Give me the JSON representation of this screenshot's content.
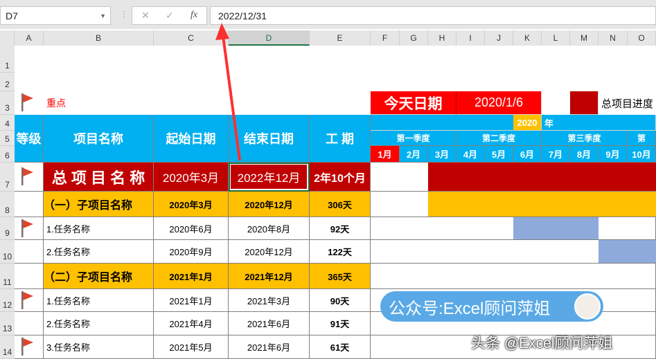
{
  "formula_bar": {
    "name_box": "D7",
    "formula": "2022/12/31",
    "cancel_icon": "✕",
    "confirm_icon": "✓",
    "fx_label": "fx"
  },
  "columns": [
    "A",
    "B",
    "C",
    "D",
    "E",
    "F",
    "G",
    "H",
    "I",
    "J",
    "K",
    "L",
    "M",
    "N",
    "O"
  ],
  "selected_column": "D",
  "rows": [
    "1",
    "2",
    "3",
    "4",
    "5",
    "6",
    "7",
    "8",
    "9",
    "10",
    "11",
    "12",
    "13",
    "14"
  ],
  "legend": {
    "flag_label": "重点",
    "today_label": "今天日期",
    "today_value": "2020/1/6",
    "overall_progress_label": "总项目进度"
  },
  "header": {
    "level": "等级",
    "name": "项目名称",
    "start": "起始日期",
    "end": "结束日期",
    "duration": "工 期",
    "year": "2020",
    "year_suffix": "年",
    "quarters": [
      "第一季度",
      "第二季度",
      "第三季度",
      "第"
    ],
    "months": [
      "1月",
      "2月",
      "3月",
      "4月",
      "5月",
      "6月",
      "7月",
      "8月",
      "9月",
      "10月"
    ]
  },
  "tasks": [
    {
      "flag": true,
      "name": "总 项 目 名 称",
      "start": "2020年3月",
      "end": "2022年12月",
      "duration": "2年10个月",
      "type": "total",
      "gantt_from_month": 3,
      "gantt_to_month": 12
    },
    {
      "flag": false,
      "name": "（一）子项目名称",
      "start": "2020年3月",
      "end": "2020年12月",
      "duration": "306天",
      "type": "sub",
      "gantt_from_month": 3,
      "gantt_to_month": 12
    },
    {
      "flag": true,
      "name": "1.任务名称",
      "start": "2020年6月",
      "end": "2020年8月",
      "duration": "92天",
      "type": "task",
      "gantt_from_month": 6,
      "gantt_to_month": 8
    },
    {
      "flag": false,
      "name": "2.任务名称",
      "start": "2020年9月",
      "end": "2020年12月",
      "duration": "122天",
      "type": "task",
      "gantt_from_month": 9,
      "gantt_to_month": 12
    },
    {
      "flag": false,
      "name": "（二）子项目名称",
      "start": "2021年1月",
      "end": "2021年12月",
      "duration": "365天",
      "type": "sub"
    },
    {
      "flag": true,
      "name": "1.任务名称",
      "start": "2021年1月",
      "end": "2021年3月",
      "duration": "90天",
      "type": "task"
    },
    {
      "flag": false,
      "name": "2.任务名称",
      "start": "2021年4月",
      "end": "2021年6月",
      "duration": "91天",
      "type": "task"
    },
    {
      "flag": true,
      "name": "3.任务名称",
      "start": "2021年5月",
      "end": "2021年6月",
      "duration": "61天",
      "type": "task"
    }
  ],
  "colors": {
    "red": "#ff0000",
    "dark_red": "#c00000",
    "orange": "#ffc000",
    "cyan": "#00b0f0",
    "blue": "#8eaadb",
    "flag": "#e0452b"
  },
  "watermark": "公众号:Excel顾问萍姐",
  "credit": "头条 @Excel顾问萍姐"
}
